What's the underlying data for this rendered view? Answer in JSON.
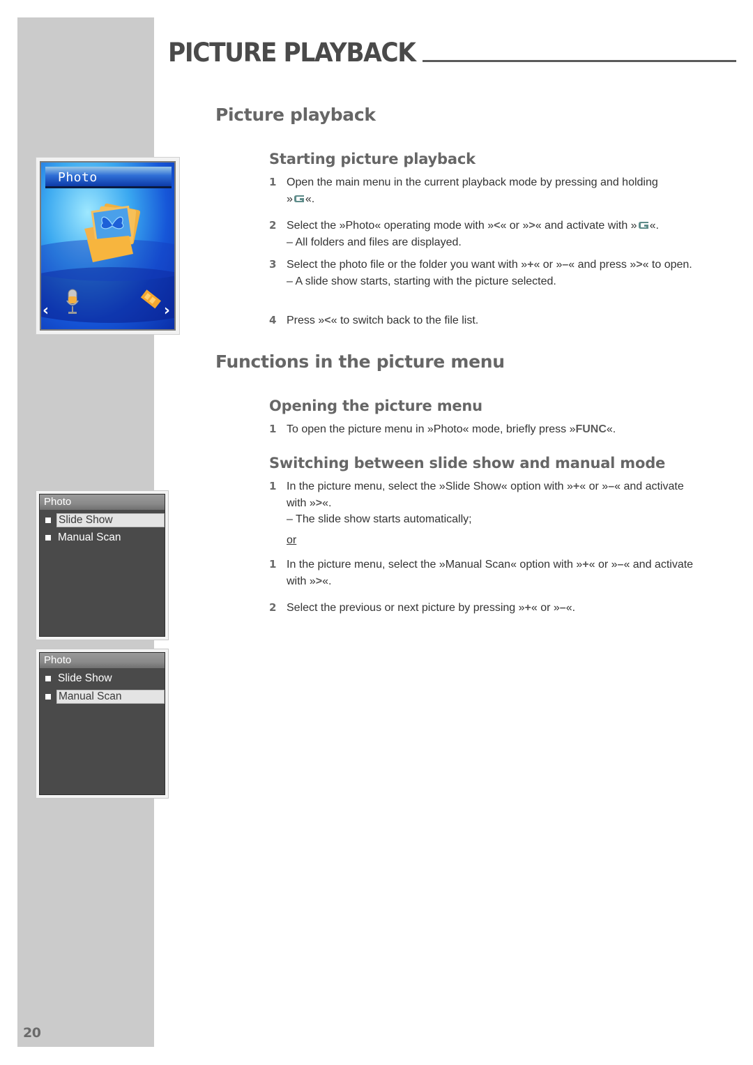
{
  "page": {
    "header_title": "PICTURE PLAYBACK",
    "page_number": "20"
  },
  "sections": {
    "picture_playback": {
      "title": "Picture playback",
      "starting": {
        "title": "Starting picture playback",
        "steps": [
          {
            "num": "1",
            "text_a": "Open the main menu in the current playback mode by pressing and holding",
            "text_b": "»",
            "key": "G-icon",
            "text_c": "«."
          },
          {
            "num": "2",
            "text_a": "Select the »Photo« operating mode with »",
            "key1": "<",
            "text_b": "« or »",
            "key2": ">",
            "text_c": "« and activate with »",
            "text_d": "«.",
            "sub": "– All folders and files are displayed."
          },
          {
            "num": "3",
            "text_a": "Select the photo file or the folder you want with »",
            "key1": "+",
            "text_b": "« or »",
            "key2": "–",
            "text_c": "« and press »",
            "key3": ">",
            "text_d": "« to open.",
            "sub": "– A slide show starts, starting with the picture selected."
          },
          {
            "num": "4",
            "text_a": "Press »",
            "key1": "<",
            "text_b": "« to switch back to the file list."
          }
        ]
      }
    },
    "functions": {
      "title": "Functions in the picture menu",
      "opening": {
        "title": "Opening the picture menu",
        "steps": [
          {
            "num": "1",
            "text_a": "To open the picture menu in »Photo« mode, briefly press »",
            "key1": "FUNC",
            "text_b": "«."
          }
        ]
      },
      "switching": {
        "title": "Switching between slide show and manual mode",
        "steps_a": [
          {
            "num": "1",
            "text_a": "In the picture menu, select the »Slide Show« option with »",
            "key1": "+",
            "text_b": "« or »",
            "key2": "–",
            "text_c": "« and activate with »",
            "key3": ">",
            "text_d": "«.",
            "sub": "– The slide show starts automatically;"
          }
        ],
        "or_label": "or",
        "steps_b": [
          {
            "num": "1",
            "text_a": "In the picture menu, select the »Manual Scan« option with »",
            "key1": "+",
            "text_b": "« or »",
            "key2": "–",
            "text_c": "« and activate with »",
            "key3": ">",
            "text_d": "«."
          },
          {
            "num": "2",
            "text_a": "Select the previous or next picture by pressing »",
            "key1": "+",
            "text_b": "« or »",
            "key2": "–",
            "text_c": "«."
          }
        ]
      }
    }
  },
  "screens": {
    "photo_home": {
      "title": "Photo",
      "left_arrow": "‹",
      "right_arrow": "›",
      "icons": [
        "photo-folder-icon",
        "microphone-icon",
        "film-icon"
      ]
    },
    "menu_slideshow": {
      "title": "Photo",
      "items": [
        {
          "label": "Slide Show",
          "selected": true
        },
        {
          "label": "Manual Scan",
          "selected": false
        }
      ]
    },
    "menu_manual": {
      "title": "Photo",
      "items": [
        {
          "label": "Slide Show",
          "selected": false
        },
        {
          "label": "Manual Scan",
          "selected": true
        }
      ]
    }
  },
  "colors": {
    "sidebar": "#cbcbcb",
    "heading": "#666666",
    "g_key": "#5e8c8a",
    "body_text": "#333333"
  }
}
